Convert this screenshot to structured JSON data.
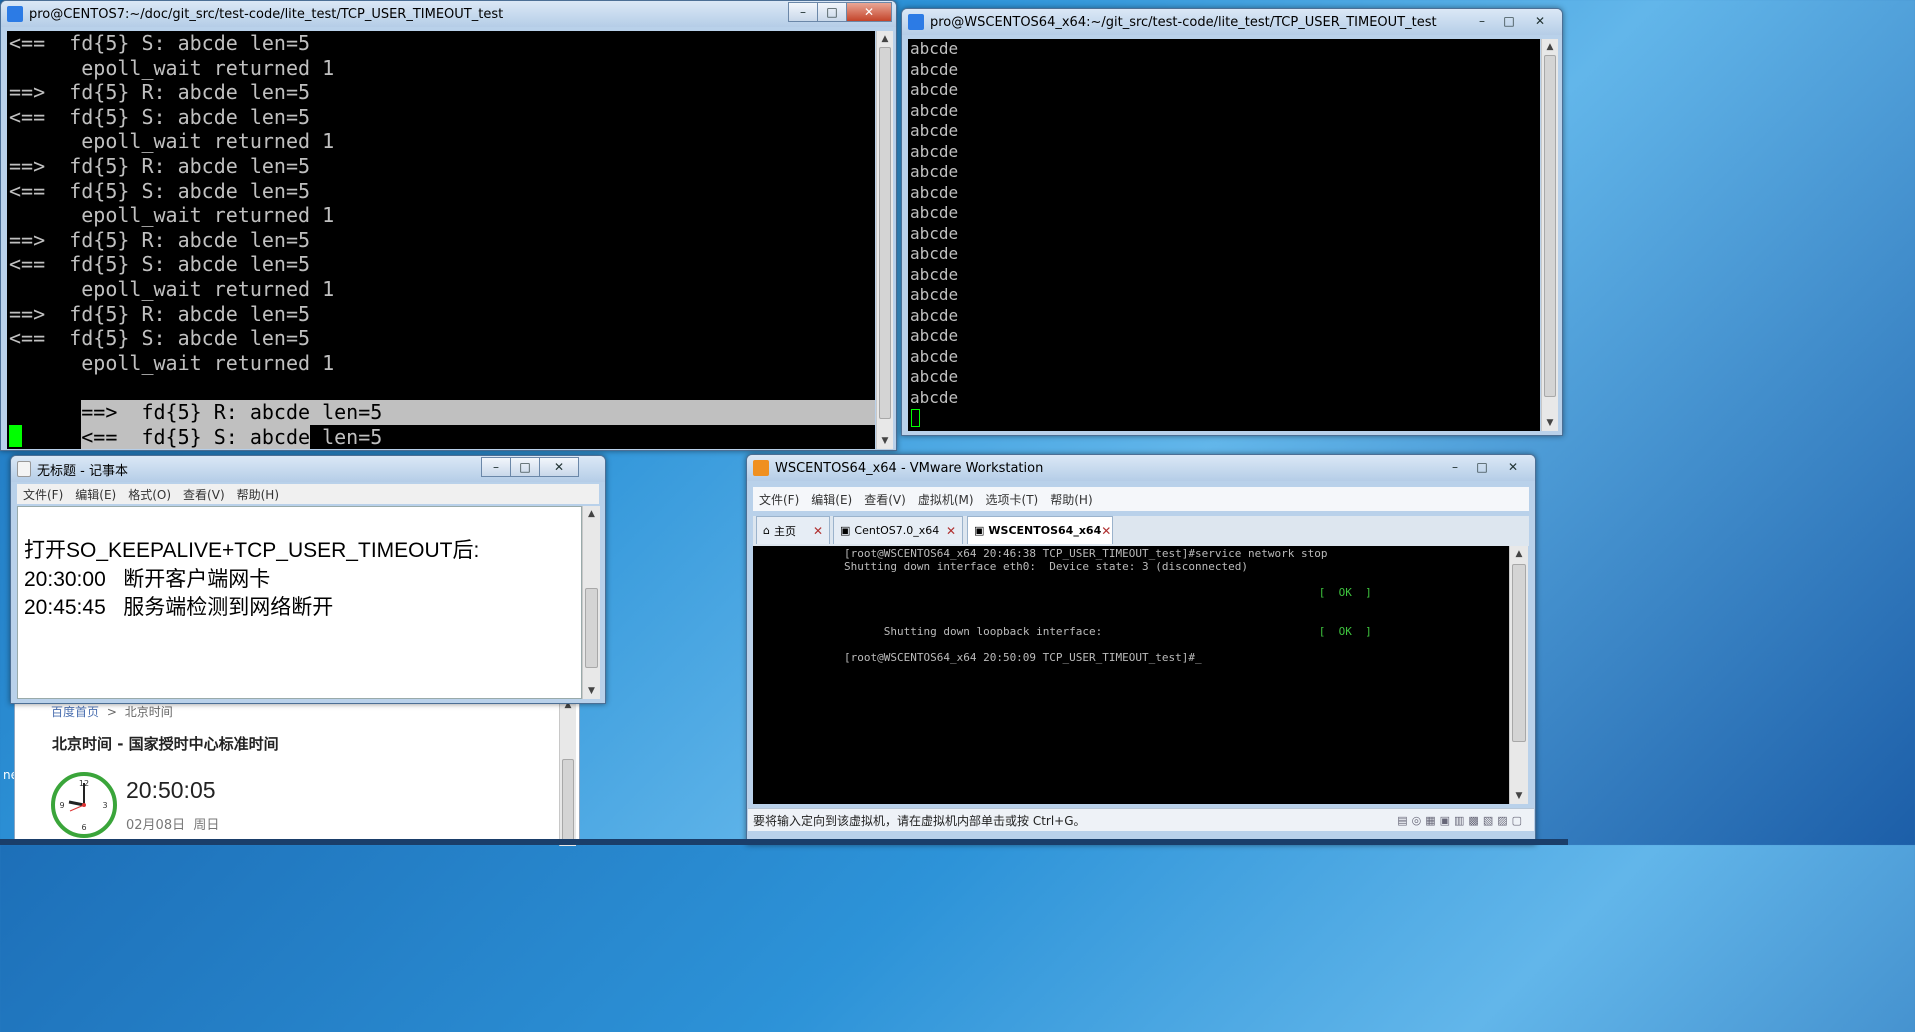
{
  "putty_left": {
    "title": "pro@CENTOS7:~/doc/git_src/test-code/lite_test/TCP_USER_TIMEOUT_test",
    "lines": [
      "<==  fd{5} S: abcde len=5",
      "      epoll_wait returned 1",
      "==>  fd{5} R: abcde len=5",
      "<==  fd{5} S: abcde len=5",
      "      epoll_wait returned 1",
      "==>  fd{5} R: abcde len=5",
      "<==  fd{5} S: abcde len=5",
      "      epoll_wait returned 1",
      "==>  fd{5} R: abcde len=5",
      "<==  fd{5} S: abcde len=5",
      "      epoll_wait returned 1",
      "==>  fd{5} R: abcde len=5",
      "<==  fd{5} S: abcde len=5",
      "      epoll_wait returned 1"
    ],
    "sel_line_1": "==>  fd{5} R: abcde len=5",
    "sel_line_2a": "<==  fd{5} S: abcde",
    "sel_line_2b": " len=5"
  },
  "putty_right": {
    "title": "pro@WSCENTOS64_x64:~/git_src/test-code/lite_test/TCP_USER_TIMEOUT_test",
    "lines": [
      "abcde",
      "abcde",
      "abcde",
      "abcde",
      "abcde",
      "abcde",
      "abcde",
      "abcde",
      "abcde",
      "abcde",
      "abcde",
      "abcde",
      "abcde",
      "abcde",
      "abcde",
      "abcde",
      "abcde",
      "abcde"
    ]
  },
  "notepad": {
    "title": "无标题 - 记事本",
    "menu": [
      "文件(F)",
      "编辑(E)",
      "格式(O)",
      "查看(V)",
      "帮助(H)"
    ],
    "lines": [
      "打开SO_KEEPALIVE+TCP_USER_TIMEOUT后:",
      "20:30:00   断开客户端网卡",
      "20:45:45   服务端检测到网络断开"
    ]
  },
  "browser": {
    "breadcrumb_home": "百度首页",
    "breadcrumb_sep": ">",
    "breadcrumb_current": "北京时间",
    "heading": "北京时间 - 国家授时中心标准时间",
    "time": "20:50:05",
    "date": "02月08日",
    "weekday": "周日",
    "clock_hours": [
      12,
      3,
      6,
      9
    ]
  },
  "vmware": {
    "title": "WSCENTOS64_x64 - VMware Workstation",
    "menu": [
      "文件(F)",
      "编辑(E)",
      "查看(V)",
      "虚拟机(M)",
      "选项卡(T)",
      "帮助(H)"
    ],
    "tabs": [
      {
        "label": "主页"
      },
      {
        "label": "CentOS7.0_x64"
      },
      {
        "label": "WSCENTOS64_x64"
      }
    ],
    "console": [
      "[root@WSCENTOS64_x64 20:46:38 TCP_USER_TIMEOUT_test]#service network stop",
      "Shutting down interface eth0:  Device state: 3 (disconnected)",
      "",
      "Shutting down loopback interface:",
      "[root@WSCENTOS64_x64 20:50:09 TCP_USER_TIMEOUT_test]#_"
    ],
    "ok_label": "[  OK  ]",
    "status": "要将输入定向到该虚拟机，请在虚拟机内部单击或按 Ctrl+G。"
  },
  "desktop": {
    "partial_label": "nev"
  },
  "colors": {
    "putty_icon": "#2c7be5",
    "cursor_green": "#00ff00",
    "ok_green": "#3ec43e"
  }
}
